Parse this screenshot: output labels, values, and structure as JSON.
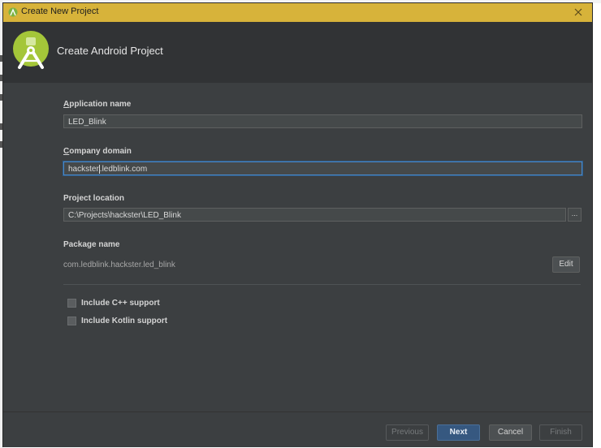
{
  "window": {
    "title": "Create New Project"
  },
  "header": {
    "title": "Create Android Project",
    "icon": "android-studio-logo"
  },
  "form": {
    "app_name_label_u": "A",
    "app_name_label_rest": "pplication name",
    "app_name_value": "LED_Blink",
    "company_label_u": "C",
    "company_label_rest": "ompany domain",
    "company_value_a": "hackster",
    "company_value_b": ".ledblink.com",
    "location_label": "Project location",
    "location_value": "C:\\Projects\\hackster\\LED_Blink",
    "browse_label": "...",
    "package_label": "Package name",
    "package_value": "com.ledblink.hackster.led_blink",
    "edit_label": "Edit",
    "cpp_label": "Include C++ support",
    "kotlin_label": "Include Kotlin support"
  },
  "footer": {
    "previous": "Previous",
    "next": "Next",
    "cancel": "Cancel",
    "finish": "Finish"
  },
  "colors": {
    "titlebar": "#d7b33a",
    "header": "#313335",
    "body": "#3c3f41",
    "primary_button": "#365880",
    "focus_border": "#4a88c7",
    "android_green": "#a4c639"
  }
}
